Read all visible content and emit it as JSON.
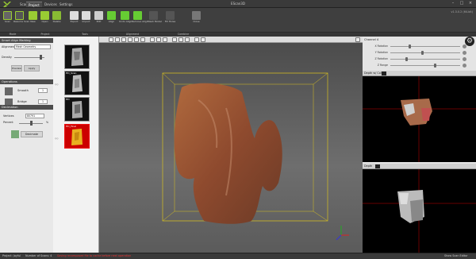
{
  "app": {
    "title": "EScan3D",
    "version": "v1.3.0.2 (64-bit)"
  },
  "menu_tabs": [
    {
      "label": "Scan"
    },
    {
      "label": "Project"
    },
    {
      "label": "Devices"
    },
    {
      "label": "Settings"
    }
  ],
  "ribbon": {
    "buttons": [
      {
        "label": "Scan"
      },
      {
        "label": "Resume Scan"
      },
      {
        "label": "New"
      },
      {
        "label": "Open"
      },
      {
        "label": "Delete"
      },
      {
        "label": "Export"
      },
      {
        "label": "Import"
      },
      {
        "label": "Edit"
      },
      {
        "label": "Align"
      },
      {
        "label": "Undo Align"
      },
      {
        "label": "Remove Align"
      },
      {
        "label": "Mesh Model"
      },
      {
        "label": "Fill Holes"
      },
      {
        "label": "Close"
      }
    ],
    "groups": [
      {
        "label": "Mode"
      },
      {
        "label": "Project"
      },
      {
        "label": "Tools"
      },
      {
        "label": "Alignment"
      },
      {
        "label": "Combine"
      }
    ]
  },
  "left_panel": {
    "smart_alignment": {
      "header": "Smart Align Marking",
      "alignment_label": "Alignment",
      "alignment_value": "Mesh Geometry",
      "density_label": "Density",
      "preview_label": "Preview",
      "apply_label": "Apply"
    },
    "operations": {
      "header": "Operations",
      "smooth_label": "Smooth",
      "smooth_value": "1",
      "bridge_label": "Bridge",
      "bridge_value": "1"
    },
    "decimation": {
      "header": "Decimation",
      "vertices_label": "Vertices",
      "vertices_value": "80791",
      "percent_label": "Percent",
      "percent_value": "%",
      "button_label": "Decimate"
    }
  },
  "scans": [
    {
      "label": "",
      "selected": false
    },
    {
      "label": "HD_Scan",
      "selected": false
    },
    {
      "label": "HD",
      "selected": false
    },
    {
      "label": "HD_Final",
      "selected": true
    }
  ],
  "right_panel": {
    "header": "Channel 4",
    "sliders": [
      {
        "label": "X Rotation",
        "value": 0.3
      },
      {
        "label": "Y Rotation",
        "value": 0.45
      },
      {
        "label": "Z Rotation",
        "value": 0.25
      },
      {
        "label": "Z Range",
        "value": 0.6
      }
    ],
    "depth_label": "Depth w/ Coll",
    "color_label": "Depth"
  },
  "statusbar": {
    "project": "Project: Joyful",
    "scans": "Number of Scans: 4",
    "warning": "Saving recomposed file to cache before next operation",
    "right": "Show Scan Editor"
  },
  "colors": {
    "accent": "#e11",
    "selection": "#ff0",
    "bg": "#2b2b2b"
  }
}
